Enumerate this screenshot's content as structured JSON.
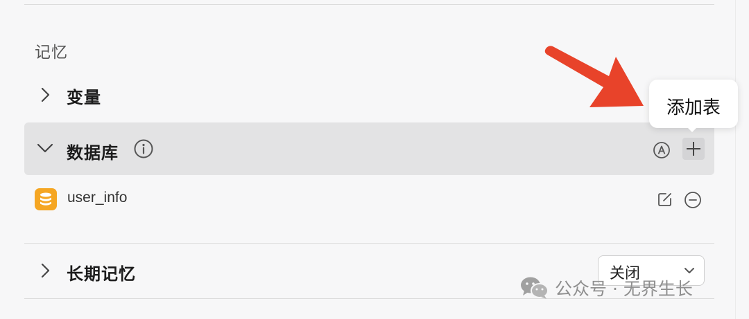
{
  "memory": {
    "section_title": "记忆",
    "variables_label": "变量",
    "database_label": "数据库",
    "tooltip_text": "添加表",
    "table_name": "user_info",
    "long_term_label": "长期记忆",
    "long_term_select_value": "关闭"
  },
  "watermark": {
    "text": "公众号 · 无界生长"
  },
  "icons": {
    "arrow_color": "#e8432a",
    "db_icon_color": "#f5a623",
    "row_chevron": "chevron-right-icon",
    "db_chevron": "chevron-down-icon",
    "info": "info-icon",
    "auto": "auto-circle-icon",
    "add": "plus-icon",
    "edit": "edit-icon",
    "remove": "minus-circle-icon",
    "select": "chevron-down-icon",
    "watermark": "wechat-icon"
  }
}
